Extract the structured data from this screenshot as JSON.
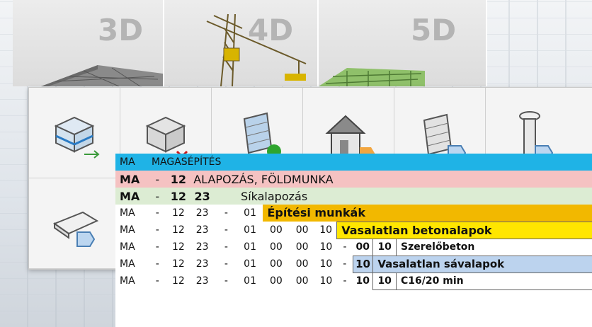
{
  "tiles": [
    {
      "label": "3D"
    },
    {
      "label": "4D"
    },
    {
      "label": "5D"
    }
  ],
  "toolbar": {
    "icons": [
      "object-to-element-icon",
      "delete-element-icon",
      "wall-refresh-icon",
      "house-tag-icon",
      "wall-tag-icon",
      "column-tag-icon",
      "slab-tag-icon"
    ]
  },
  "table": {
    "header": {
      "code": "MA",
      "title": "MAGASÉPÍTÉS"
    },
    "level1": {
      "code": "MA",
      "dash": "-",
      "n1": "12",
      "title": "ALAPOZÁS, FÖLDMUNKA"
    },
    "level2": {
      "code": "MA",
      "dash": "-",
      "n1": "12",
      "n2": "23",
      "title": "Síkalapozás"
    },
    "level3": {
      "code": "MA",
      "dash": "-",
      "n1": "12",
      "n2": "23",
      "dash2": "-",
      "n3": "01",
      "title": "Építési munkák"
    },
    "level4": {
      "code": "MA",
      "dash": "-",
      "n1": "12",
      "n2": "23",
      "dash2": "-",
      "n3": "01",
      "n4": "00",
      "n5": "00",
      "n6": "10",
      "title": "Vasalatlan betonalapok"
    },
    "level5": {
      "code": "MA",
      "dash": "-",
      "n1": "12",
      "n2": "23",
      "dash2": "-",
      "n3": "01",
      "n4": "00",
      "n5": "00",
      "n6": "10",
      "dash3": "-",
      "n7": "00",
      "n8": "10",
      "title": "Szerelőbeton"
    },
    "level6": {
      "code": "MA",
      "dash": "-",
      "n1": "12",
      "n2": "23",
      "dash2": "-",
      "n3": "01",
      "n4": "00",
      "n5": "00",
      "n6": "10",
      "dash3": "-",
      "n7": "10",
      "title": "Vasalatlan sávalapok"
    },
    "level7": {
      "code": "MA",
      "dash": "-",
      "n1": "12",
      "n2": "23",
      "dash2": "-",
      "n3": "01",
      "n4": "00",
      "n5": "00",
      "n6": "10",
      "dash3": "-",
      "n7": "10",
      "n8": "10",
      "title": "C16/20 min"
    }
  },
  "colors": {
    "header": "#1fb3e6",
    "level1": "#f5c2c2",
    "level2": "#dcecd3",
    "level3": "#f2b800",
    "level4": "#ffe600",
    "level6": "#bcd3ee"
  }
}
